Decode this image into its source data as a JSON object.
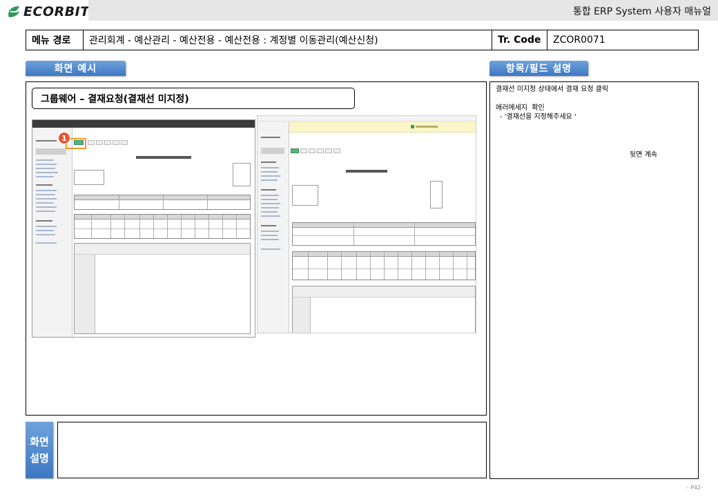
{
  "header": {
    "logo_text": "ECORBIT",
    "doc_title": "통합 ERP System 사용자 매뉴얼"
  },
  "menu_path": {
    "label": "메뉴 경로",
    "path": "관리회계 - 예산관리 - 예산전용 - 예산전용 : 계정별 이동관리(예산신청)",
    "tr_label": "Tr. Code",
    "tr_code": "ZCOR0071"
  },
  "sections": {
    "example_tab": "화면 예시",
    "field_tab": "항목/필드 설명",
    "description_label_1": "화면",
    "description_label_2": "설명"
  },
  "example": {
    "title": "그룹웨어 – 결재요청(결재선 미지정)",
    "marker_number": "1"
  },
  "fields": {
    "line1": "결재선 미지정 상태에서 결재 요청 클릭",
    "line2": "에러메세지  확인",
    "line3": "- '결재선을 지정해주세요 '",
    "continued": "뒷면 계속"
  },
  "screen_description": "",
  "footer": {
    "page": "- P42-"
  },
  "colors": {
    "tab_blue": "#3d77c2",
    "marker_red": "#e4572e",
    "highlight_orange": "#f39a2b",
    "header_gray": "#e6e6e6",
    "logo_green": "#2e9a5b"
  },
  "icons": {
    "logo": "ecorbit-leaf-icon",
    "marker": "step-marker-icon"
  }
}
